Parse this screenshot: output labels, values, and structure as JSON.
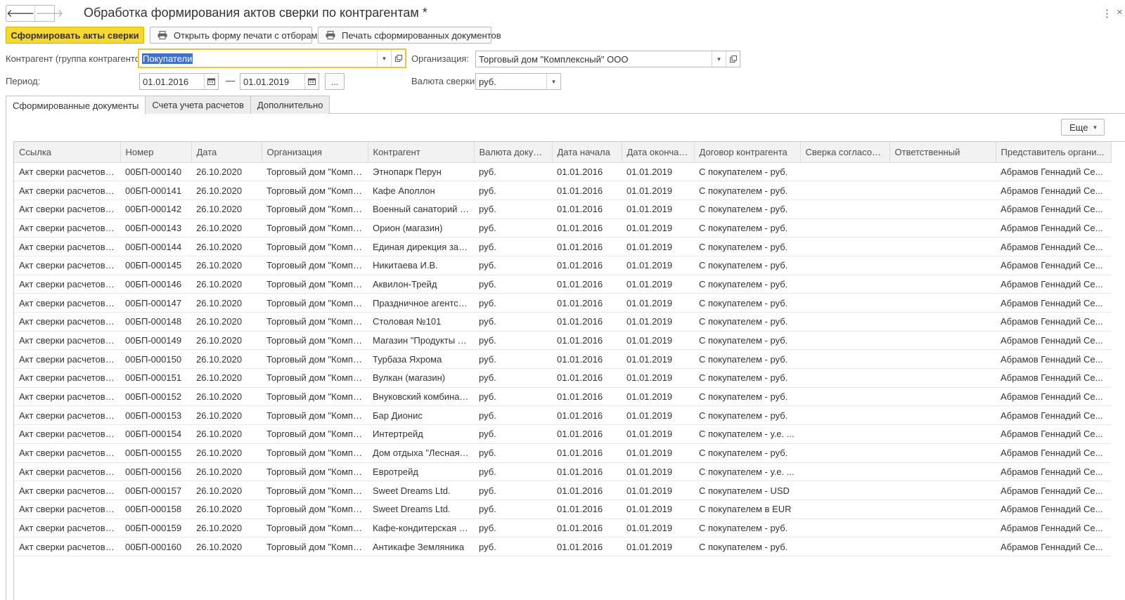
{
  "window": {
    "title": "Обработка формирования актов сверки по контрагентам *",
    "back_glyph": "🡐",
    "forward_glyph": "🡒",
    "menu_glyph": "⋮",
    "close_glyph": "×"
  },
  "toolbar": {
    "generate_label": "Сформировать акты сверки",
    "print_form_label": "Открыть форму печати с отборами",
    "print_docs_label": "Печать сформированных документов"
  },
  "form": {
    "counterparty_label": "Контрагент (группа контрагентов):",
    "counterparty_value": "Покупатели",
    "organization_label": "Организация:",
    "organization_value": "Торговый дом \"Комплексный\" ООО",
    "period_label": "Период:",
    "period_from": "01.01.2016",
    "period_to": "01.01.2019",
    "period_dash": "—",
    "period_more": "...",
    "currency_label": "Валюта сверки:",
    "currency_value": "руб."
  },
  "tabs": [
    "Сформированные документы",
    "Счета учета расчетов",
    "Дополнительно"
  ],
  "more_label": "Еще",
  "table": {
    "columns": [
      "Ссылка",
      "Номер",
      "Дата",
      "Организация",
      "Контрагент",
      "Валюта докум...",
      "Дата начала",
      "Дата окончания",
      "Договор контрагента",
      "Сверка согласована",
      "Ответственный",
      "Представитель органи..."
    ],
    "rows": [
      [
        "Акт сверки расчетов с...",
        "00БП-000140",
        "26.10.2020",
        "Торговый дом \"Компл...",
        "Этнопарк Перун",
        "руб.",
        "01.01.2016",
        "01.01.2019",
        "С покупателем - руб.",
        "",
        "",
        "Абрамов Геннадий Се..."
      ],
      [
        "Акт сверки расчетов с...",
        "00БП-000141",
        "26.10.2020",
        "Торговый дом \"Компл...",
        "Кафе Аполлон",
        "руб.",
        "01.01.2016",
        "01.01.2019",
        "С покупателем - руб.",
        "",
        "",
        "Абрамов Геннадий Се..."
      ],
      [
        "Акт сверки расчетов с...",
        "00БП-000142",
        "26.10.2020",
        "Торговый дом \"Компл...",
        "Военный санаторий \"...",
        "руб.",
        "01.01.2016",
        "01.01.2019",
        "С покупателем - руб.",
        "",
        "",
        "Абрамов Геннадий Се..."
      ],
      [
        "Акт сверки расчетов с...",
        "00БП-000143",
        "26.10.2020",
        "Торговый дом \"Компл...",
        "Орион (магазин)",
        "руб.",
        "01.01.2016",
        "01.01.2019",
        "С покупателем - руб.",
        "",
        "",
        "Абрамов Геннадий Се..."
      ],
      [
        "Акт сверки расчетов с...",
        "00БП-000144",
        "26.10.2020",
        "Торговый дом \"Компл...",
        "Единая дирекция зак...",
        "руб.",
        "01.01.2016",
        "01.01.2019",
        "С покупателем - руб.",
        "",
        "",
        "Абрамов Геннадий Се..."
      ],
      [
        "Акт сверки расчетов с...",
        "00БП-000145",
        "26.10.2020",
        "Торговый дом \"Компл...",
        "Никитаева И.В.",
        "руб.",
        "01.01.2016",
        "01.01.2019",
        "С покупателем - руб.",
        "",
        "",
        "Абрамов Геннадий Се..."
      ],
      [
        "Акт сверки расчетов с...",
        "00БП-000146",
        "26.10.2020",
        "Торговый дом \"Компл...",
        "Аквилон-Трейд",
        "руб.",
        "01.01.2016",
        "01.01.2019",
        "С покупателем - руб.",
        "",
        "",
        "Абрамов Геннадий Се..."
      ],
      [
        "Акт сверки расчетов с...",
        "00БП-000147",
        "26.10.2020",
        "Торговый дом \"Компл...",
        "Праздничное агентств...",
        "руб.",
        "01.01.2016",
        "01.01.2019",
        "С покупателем - руб.",
        "",
        "",
        "Абрамов Геннадий Се..."
      ],
      [
        "Акт сверки расчетов с...",
        "00БП-000148",
        "26.10.2020",
        "Торговый дом \"Компл...",
        "Столовая №101",
        "руб.",
        "01.01.2016",
        "01.01.2019",
        "С покупателем - руб.",
        "",
        "",
        "Абрамов Геннадий Се..."
      ],
      [
        "Акт сверки расчетов с...",
        "00БП-000149",
        "26.10.2020",
        "Торговый дом \"Компл...",
        "Магазин \"Продукты 2...",
        "руб.",
        "01.01.2016",
        "01.01.2019",
        "С покупателем - руб.",
        "",
        "",
        "Абрамов Геннадий Се..."
      ],
      [
        "Акт сверки расчетов с...",
        "00БП-000150",
        "26.10.2020",
        "Торговый дом \"Компл...",
        "Турбаза Яхрома",
        "руб.",
        "01.01.2016",
        "01.01.2019",
        "С покупателем - руб.",
        "",
        "",
        "Абрамов Геннадий Се..."
      ],
      [
        "Акт сверки расчетов с...",
        "00БП-000151",
        "26.10.2020",
        "Торговый дом \"Компл...",
        "Вулкан (магазин)",
        "руб.",
        "01.01.2016",
        "01.01.2019",
        "С покупателем - руб.",
        "",
        "",
        "Абрамов Геннадий Се..."
      ],
      [
        "Акт сверки расчетов с...",
        "00БП-000152",
        "26.10.2020",
        "Торговый дом \"Компл...",
        "Внуковский комбинат ...",
        "руб.",
        "01.01.2016",
        "01.01.2019",
        "С покупателем - руб.",
        "",
        "",
        "Абрамов Геннадий Се..."
      ],
      [
        "Акт сверки расчетов с...",
        "00БП-000153",
        "26.10.2020",
        "Торговый дом \"Компл...",
        "Бар Дионис",
        "руб.",
        "01.01.2016",
        "01.01.2019",
        "С покупателем - руб.",
        "",
        "",
        "Абрамов Геннадий Се..."
      ],
      [
        "Акт сверки расчетов с...",
        "00БП-000154",
        "26.10.2020",
        "Торговый дом \"Компл...",
        "Интертрейд",
        "руб.",
        "01.01.2016",
        "01.01.2019",
        "С покупателем - у.е. ...",
        "",
        "",
        "Абрамов Геннадий Се..."
      ],
      [
        "Акт сверки расчетов с...",
        "00БП-000155",
        "26.10.2020",
        "Торговый дом \"Компл...",
        "Дом отдыха \"Лесная ...",
        "руб.",
        "01.01.2016",
        "01.01.2019",
        "С покупателем - руб.",
        "",
        "",
        "Абрамов Геннадий Се..."
      ],
      [
        "Акт сверки расчетов с...",
        "00БП-000156",
        "26.10.2020",
        "Торговый дом \"Компл...",
        "Евротрейд",
        "руб.",
        "01.01.2016",
        "01.01.2019",
        "С покупателем - у.е. ...",
        "",
        "",
        "Абрамов Геннадий Се..."
      ],
      [
        "Акт сверки расчетов с...",
        "00БП-000157",
        "26.10.2020",
        "Торговый дом \"Компл...",
        "Sweet Dreams Ltd.",
        "руб.",
        "01.01.2016",
        "01.01.2019",
        "С покупателем - USD",
        "",
        "",
        "Абрамов Геннадий Се..."
      ],
      [
        "Акт сверки расчетов с...",
        "00БП-000158",
        "26.10.2020",
        "Торговый дом \"Компл...",
        "Sweet Dreams Ltd.",
        "руб.",
        "01.01.2016",
        "01.01.2019",
        "С покупателем в EUR",
        "",
        "",
        "Абрамов Геннадий Се..."
      ],
      [
        "Акт сверки расчетов с...",
        "00БП-000159",
        "26.10.2020",
        "Торговый дом \"Компл...",
        "Кафе-кондитерская \"З...",
        "руб.",
        "01.01.2016",
        "01.01.2019",
        "С покупателем - руб.",
        "",
        "",
        "Абрамов Геннадий Се..."
      ],
      [
        "Акт сверки расчетов с...",
        "00БП-000160",
        "26.10.2020",
        "Торговый дом \"Компл...",
        "Антикафе Земляника",
        "руб.",
        "01.01.2016",
        "01.01.2019",
        "С покупателем - руб.",
        "",
        "",
        "Абрамов Геннадий Се..."
      ]
    ]
  },
  "colors": {
    "primary_button": "#f7d82d",
    "focus_border": "#f2c230",
    "selection": "#3f6fd1"
  },
  "icons": {
    "printer": "printer-icon",
    "dropdown": "chevron-down-icon",
    "open": "open-in-window-icon",
    "calendar": "calendar-icon"
  }
}
